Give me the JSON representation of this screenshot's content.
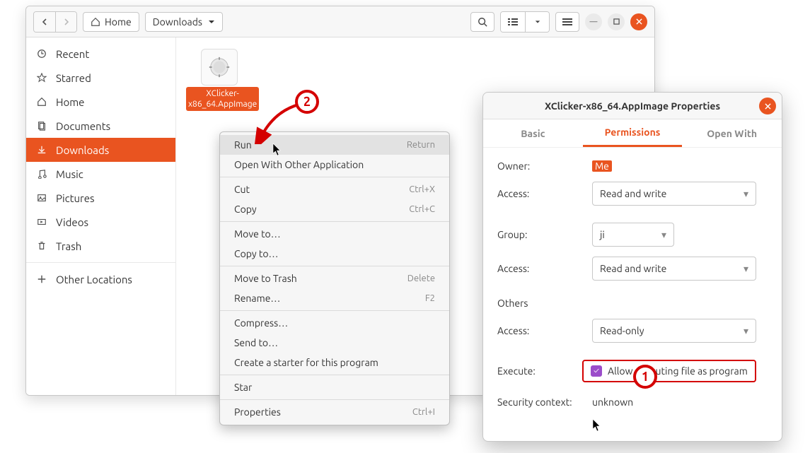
{
  "toolbar": {
    "home_label": "Home",
    "downloads_label": "Downloads"
  },
  "sidebar": {
    "items": [
      {
        "label": "Recent"
      },
      {
        "label": "Starred"
      },
      {
        "label": "Home"
      },
      {
        "label": "Documents"
      },
      {
        "label": "Downloads"
      },
      {
        "label": "Music"
      },
      {
        "label": "Pictures"
      },
      {
        "label": "Videos"
      },
      {
        "label": "Trash"
      },
      {
        "label": "Other Locations"
      }
    ]
  },
  "file": {
    "name": "XClicker-x86_64.AppImage"
  },
  "statusbar": "\"XClicker-x86",
  "context_menu": {
    "items": [
      {
        "label": "Run",
        "shortcut": "Return",
        "hover": true
      },
      {
        "label": "Open With Other Application"
      },
      {
        "sep": true
      },
      {
        "label": "Cut",
        "shortcut": "Ctrl+X"
      },
      {
        "label": "Copy",
        "shortcut": "Ctrl+C"
      },
      {
        "sep": true
      },
      {
        "label": "Move to…"
      },
      {
        "label": "Copy to…"
      },
      {
        "sep": true
      },
      {
        "label": "Move to Trash",
        "shortcut": "Delete"
      },
      {
        "label": "Rename…",
        "shortcut": "F2"
      },
      {
        "sep": true
      },
      {
        "label": "Compress…"
      },
      {
        "label": "Send to…"
      },
      {
        "label": "Create a starter for this program"
      },
      {
        "sep": true
      },
      {
        "label": "Star"
      },
      {
        "sep": true
      },
      {
        "label": "Properties",
        "shortcut": "Ctrl+I"
      }
    ]
  },
  "properties": {
    "title": "XClicker-x86_64.AppImage Properties",
    "tabs": {
      "basic": "Basic",
      "permissions": "Permissions",
      "openwith": "Open With"
    },
    "owner_label": "Owner:",
    "owner_value": "Me",
    "access_label": "Access:",
    "owner_access": "Read and write",
    "group_label": "Group:",
    "group_value": "ji",
    "group_access": "Read and write",
    "others_label": "Others",
    "others_access": "Read-only",
    "execute_label": "Execute:",
    "execute_text": "Allow executing file as program",
    "secctx_label": "Security context:",
    "secctx_value": "unknown"
  },
  "annotations": {
    "one": "1",
    "two": "2"
  }
}
